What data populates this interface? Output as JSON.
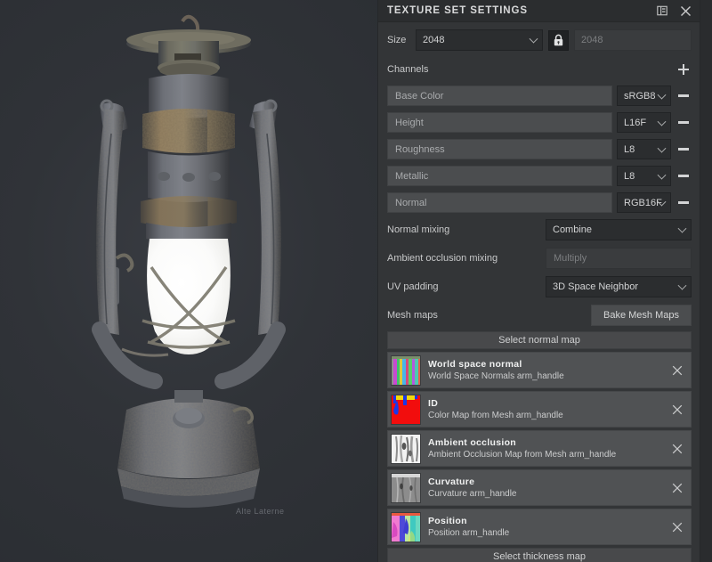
{
  "panel": {
    "title": "TEXTURE SET SETTINGS",
    "dock_icon": "panel-layout-icon",
    "close_icon": "close-icon"
  },
  "size": {
    "label": "Size",
    "value": "2048",
    "lock_icon": "lock-closed-icon",
    "locked_value": "2048"
  },
  "channels": {
    "label": "Channels",
    "add_icon": "plus-icon",
    "items": [
      {
        "name": "Base Color",
        "format": "sRGB8"
      },
      {
        "name": "Height",
        "format": "L16F"
      },
      {
        "name": "Roughness",
        "format": "L8"
      },
      {
        "name": "Metallic",
        "format": "L8"
      },
      {
        "name": "Normal",
        "format": "RGB16F"
      }
    ]
  },
  "mixing": {
    "normal_label": "Normal mixing",
    "normal_value": "Combine",
    "ao_label": "Ambient occlusion mixing",
    "ao_value": "Multiply",
    "uv_label": "UV padding",
    "uv_value": "3D Space Neighbor"
  },
  "mesh_maps": {
    "label": "Mesh maps",
    "bake_button": "Bake Mesh Maps",
    "slot_normal": "Select normal map",
    "slot_thickness": "Select thickness map",
    "items": [
      {
        "title": "World space normal",
        "subtitle": "World Space Normals arm_handle",
        "thumb": "world-space-normal-thumbnail"
      },
      {
        "title": "ID",
        "subtitle": "Color Map from Mesh arm_handle",
        "thumb": "id-map-thumbnail"
      },
      {
        "title": "Ambient occlusion",
        "subtitle": "Ambient Occlusion Map from Mesh arm_handle",
        "thumb": "ambient-occlusion-thumbnail"
      },
      {
        "title": "Curvature",
        "subtitle": "Curvature arm_handle",
        "thumb": "curvature-thumbnail"
      },
      {
        "title": "Position",
        "subtitle": "Position arm_handle",
        "thumb": "position-thumbnail"
      }
    ]
  },
  "viewport": {
    "model": "rusty-blue-kerosene-lantern",
    "background_color": "#2f3237"
  },
  "colors": {
    "panel_bg": "#333537",
    "titlebar_bg": "#2b2d2f",
    "field_bg": "#4b4d4f",
    "dropdown_bg": "#2b2d2f",
    "text": "#d2d3d4",
    "muted_text": "#7c7e80"
  }
}
